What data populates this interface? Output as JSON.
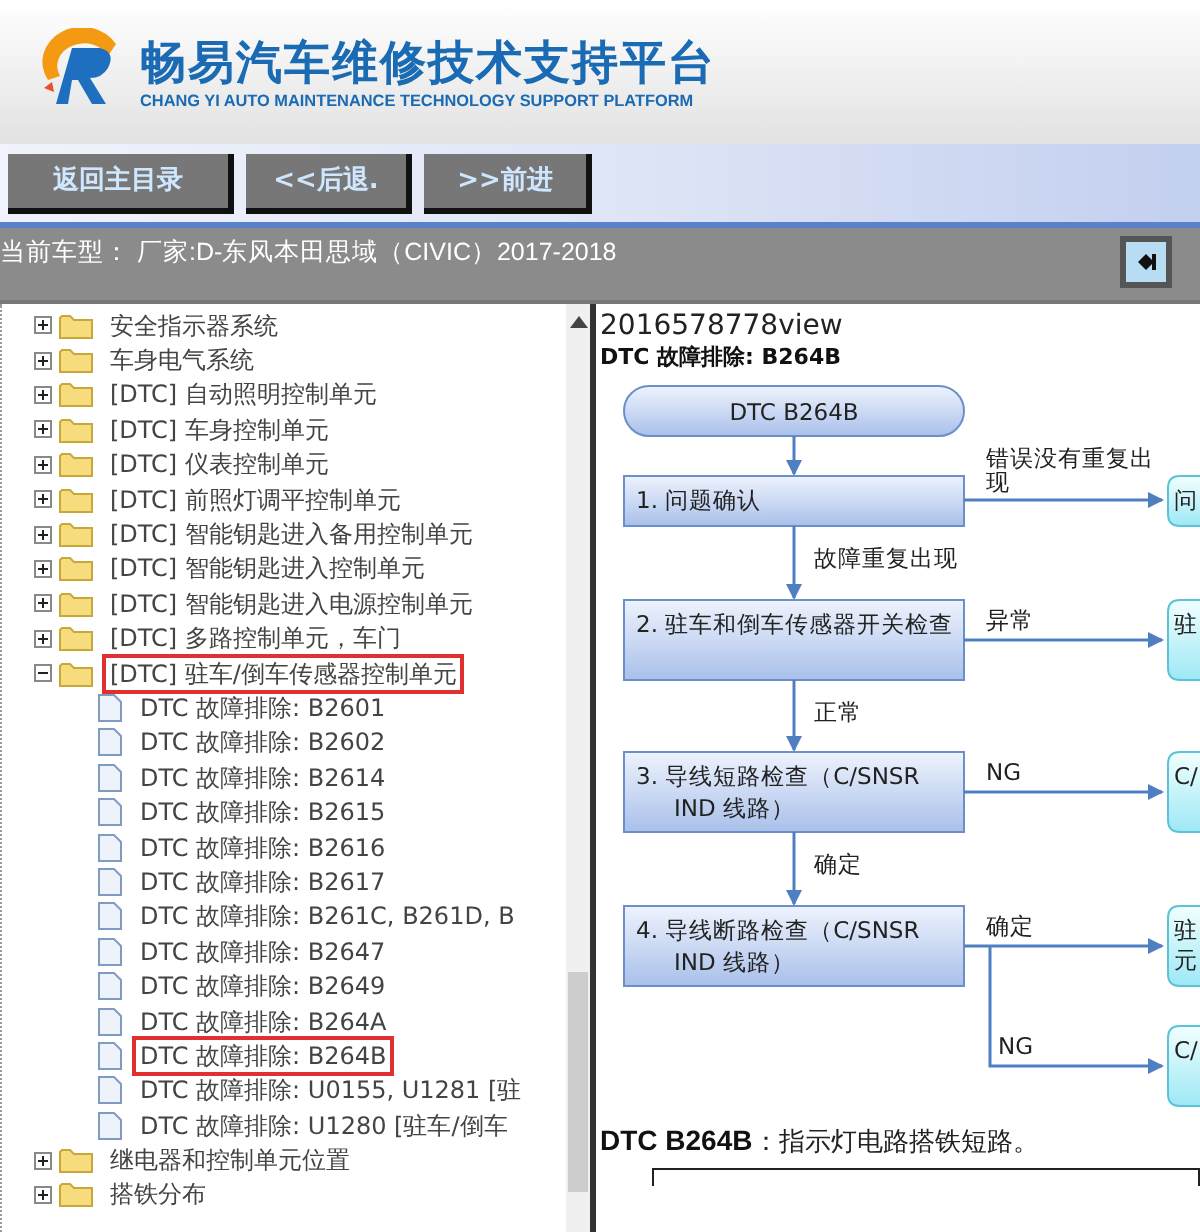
{
  "header": {
    "title": "畅易汽车维修技术支持平台",
    "subtitle": "CHANG YI AUTO MAINTENANCE TECHNOLOGY SUPPORT PLATFORM"
  },
  "nav_buttons": [
    "返回主目录",
    "<<后退.",
    ">>前进"
  ],
  "current_model": {
    "label": "当前车型：",
    "value": "厂家:D-东风本田思域（CIVIC）2017-2018"
  },
  "tree": [
    {
      "label": "安全指示器系统",
      "kind": "folder",
      "expanded": false,
      "marked": false
    },
    {
      "label": "车身电气系统",
      "kind": "folder",
      "expanded": false,
      "marked": false
    },
    {
      "label": "[DTC] 自动照明控制单元",
      "kind": "folder",
      "expanded": false,
      "marked": false
    },
    {
      "label": "[DTC] 车身控制单元",
      "kind": "folder",
      "expanded": false,
      "marked": false
    },
    {
      "label": "[DTC] 仪表控制单元",
      "kind": "folder",
      "expanded": false,
      "marked": false
    },
    {
      "label": "[DTC] 前照灯调平控制单元",
      "kind": "folder",
      "expanded": false,
      "marked": false
    },
    {
      "label": "[DTC] 智能钥匙进入备用控制单元",
      "kind": "folder",
      "expanded": false,
      "marked": false
    },
    {
      "label": "[DTC] 智能钥匙进入控制单元",
      "kind": "folder",
      "expanded": false,
      "marked": false
    },
    {
      "label": "[DTC] 智能钥匙进入电源控制单元",
      "kind": "folder",
      "expanded": false,
      "marked": false
    },
    {
      "label": "[DTC] 多路控制单元，车门",
      "kind": "folder",
      "expanded": false,
      "marked": false
    },
    {
      "label": "[DTC] 驻车/倒车传感器控制单元",
      "kind": "folder",
      "expanded": true,
      "marked": true,
      "children": [
        {
          "label": "DTC 故障排除: B2601",
          "kind": "doc",
          "marked": false
        },
        {
          "label": "DTC 故障排除: B2602",
          "kind": "doc",
          "marked": false
        },
        {
          "label": "DTC 故障排除: B2614",
          "kind": "doc",
          "marked": false
        },
        {
          "label": "DTC 故障排除: B2615",
          "kind": "doc",
          "marked": false
        },
        {
          "label": "DTC 故障排除: B2616",
          "kind": "doc",
          "marked": false
        },
        {
          "label": "DTC 故障排除: B2617",
          "kind": "doc",
          "marked": false
        },
        {
          "label": "DTC 故障排除: B261C, B261D, B",
          "kind": "doc",
          "marked": false
        },
        {
          "label": "DTC 故障排除: B2647",
          "kind": "doc",
          "marked": false
        },
        {
          "label": "DTC 故障排除: B2649",
          "kind": "doc",
          "marked": false
        },
        {
          "label": "DTC 故障排除: B264A",
          "kind": "doc",
          "marked": false
        },
        {
          "label": "DTC 故障排除: B264B",
          "kind": "doc",
          "marked": true
        },
        {
          "label": "DTC 故障排除: U0155, U1281 [驻",
          "kind": "doc",
          "marked": false
        },
        {
          "label": "DTC 故障排除: U1280 [驻车/倒车",
          "kind": "doc",
          "marked": false
        }
      ]
    },
    {
      "label": "继电器和控制单元位置",
      "kind": "folder",
      "expanded": false,
      "marked": false
    },
    {
      "label": "搭铁分布",
      "kind": "folder",
      "expanded": false,
      "marked": false
    }
  ],
  "content": {
    "view_id": "2016578778view",
    "doc_title": "DTC 故障排除: B264B",
    "flowchart": {
      "start": "DTC B264B",
      "steps": [
        {
          "lines": [
            "1.  问题确认"
          ]
        },
        {
          "lines": [
            "2.  驻车和倒车传感器开关检查"
          ]
        },
        {
          "lines": [
            "3.  导线短路检查（C/SNSR",
            "IND 线路）"
          ]
        },
        {
          "lines": [
            "4.  导线断路检查（C/SNSR",
            "IND 线路）"
          ]
        }
      ],
      "down_labels": [
        "故障重复出现",
        "正常",
        "确定"
      ],
      "branches": [
        {
          "label": [
            "错误没有重复出",
            "现"
          ],
          "target": [
            "问"
          ]
        },
        {
          "label": [
            "异常"
          ],
          "target": [
            "驻"
          ]
        },
        {
          "label": [
            "NG"
          ],
          "target": [
            "C/"
          ]
        },
        {
          "label": [
            "确定"
          ],
          "target": [
            "驻",
            "元"
          ]
        },
        {
          "label": [
            "NG"
          ],
          "target": [
            "C/"
          ]
        }
      ]
    },
    "summary": {
      "code": "DTC B264B",
      "text": "：指示灯电路搭铁短路。"
    }
  }
}
